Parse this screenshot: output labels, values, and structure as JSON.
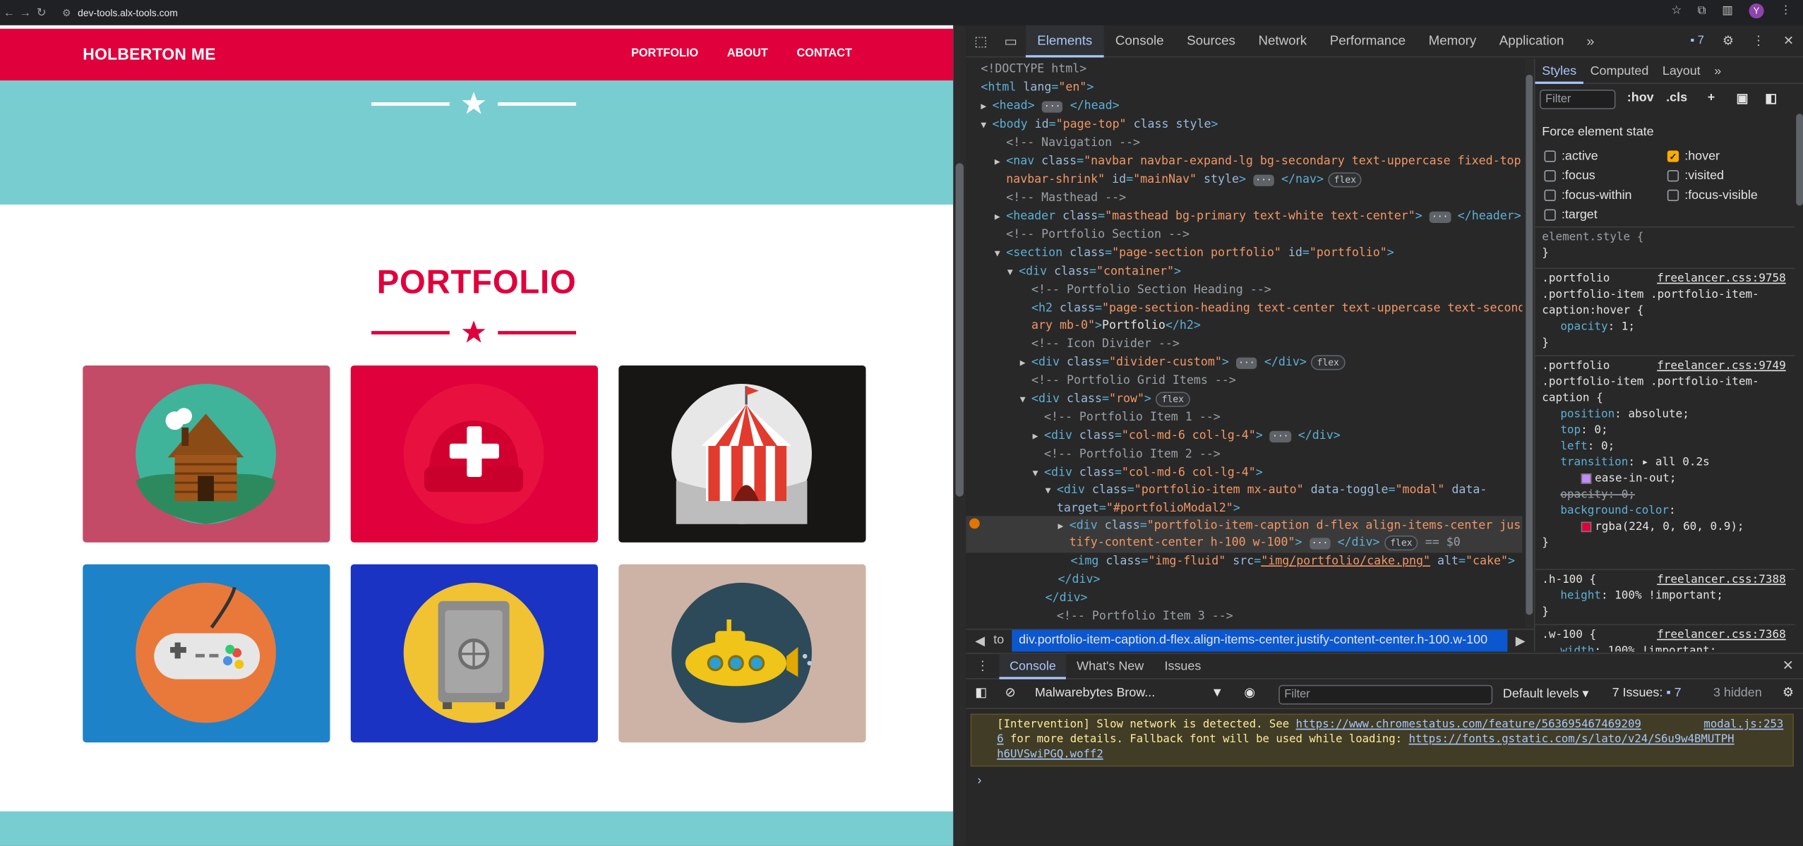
{
  "browser": {
    "url": "dev-tools.alx-tools.com",
    "avatar_letter": "Y"
  },
  "page": {
    "brand": "HOLBERTON ME",
    "nav": [
      "PORTFOLIO",
      "ABOUT",
      "CONTACT"
    ],
    "section_title": "PORTFOLIO",
    "colors": {
      "primary": "#e0003c",
      "teal": "#78cdd1"
    },
    "tiles": [
      {
        "name": "cabin",
        "bg": "#c34b68"
      },
      {
        "name": "cake",
        "bg": "#e0003c"
      },
      {
        "name": "circus",
        "bg": "#181515"
      },
      {
        "name": "game",
        "bg": "#1e82c8"
      },
      {
        "name": "safe",
        "bg": "#1a33c3"
      },
      {
        "name": "submarine",
        "bg": "#cdb3a5"
      }
    ]
  },
  "devtools": {
    "tabs": [
      "Elements",
      "Console",
      "Sources",
      "Network",
      "Performance",
      "Memory",
      "Application"
    ],
    "active_tab": "Elements",
    "issue_count": "7",
    "breadcrumb_prefix": "to",
    "breadcrumb": "div.portfolio-item-caption.d-flex.align-items-center.justify-content-center.h-100.w-100",
    "styles": {
      "tabs": [
        "Styles",
        "Computed",
        "Layout"
      ],
      "filter_placeholder": "Filter",
      "hov": ":hov",
      "cls": ".cls",
      "force_title": "Force element state",
      "states": [
        {
          "label": ":active",
          "checked": false
        },
        {
          "label": ":hover",
          "checked": true
        },
        {
          "label": ":focus",
          "checked": false
        },
        {
          "label": ":visited",
          "checked": false
        },
        {
          "label": ":focus-within",
          "checked": false
        },
        {
          "label": ":focus-visible",
          "checked": false
        },
        {
          "label": ":target",
          "checked": false
        }
      ],
      "element_style": "element.style {",
      "close_brace": "}",
      "rule1_sel_a": ".portfolio",
      "rule1_sel_b": ".portfolio-item .portfolio-item-",
      "rule1_sel_c": "caption:hover {",
      "rule1_src": "freelancer.css:9758",
      "rule1_prop": "opacity",
      "rule1_val": "1;",
      "rule2_sel_a": ".portfolio",
      "rule2_sel_b": ".portfolio-item .portfolio-item-",
      "rule2_sel_c": "caption {",
      "rule2_src": "freelancer.css:9749",
      "rule2_props": [
        {
          "p": "position",
          "v": "absolute;"
        },
        {
          "p": "top",
          "v": "0;"
        },
        {
          "p": "left",
          "v": "0;"
        },
        {
          "p": "transition",
          "v": "all 0.2s"
        }
      ],
      "ease": "ease-in-out;",
      "opacity_struck": "opacity: 0;",
      "bg_prop": "background-color",
      "bg_val": "rgba(224, 0, 60, 0.9);",
      "rule3_sel": ".h-100 {",
      "rule3_src": "freelancer.css:7388",
      "rule3_prop": "height",
      "rule3_val": "100% !important;",
      "rule4_sel": ".w-100 {",
      "rule4_src": "freelancer.css:7368",
      "rule4_prop": "width",
      "rule4_val": "100% !important;"
    },
    "console": {
      "tabs": [
        "Console",
        "What's New",
        "Issues"
      ],
      "context": "Malwarebytes Brow...",
      "filter_placeholder": "Filter",
      "levels": "Default levels",
      "issues": "7 Issues:",
      "issues_count": "7",
      "hidden": "3 hidden",
      "warn_1a": "[Intervention] Slow network is detected. See ",
      "warn_1_link": "https://www.chromestatus.com/feature/563695467469209",
      "warn_src": "modal.js:253",
      "warn_2a": "6",
      "warn_2b": " for more details. Fallback font will be used while loading: ",
      "warn_2_link": "https://fonts.gstatic.com/s/lato/v24/S6u9w4BMUTPH",
      "warn_3_link": "h6UVSwiPGQ.woff2",
      "prompt": "›"
    }
  }
}
